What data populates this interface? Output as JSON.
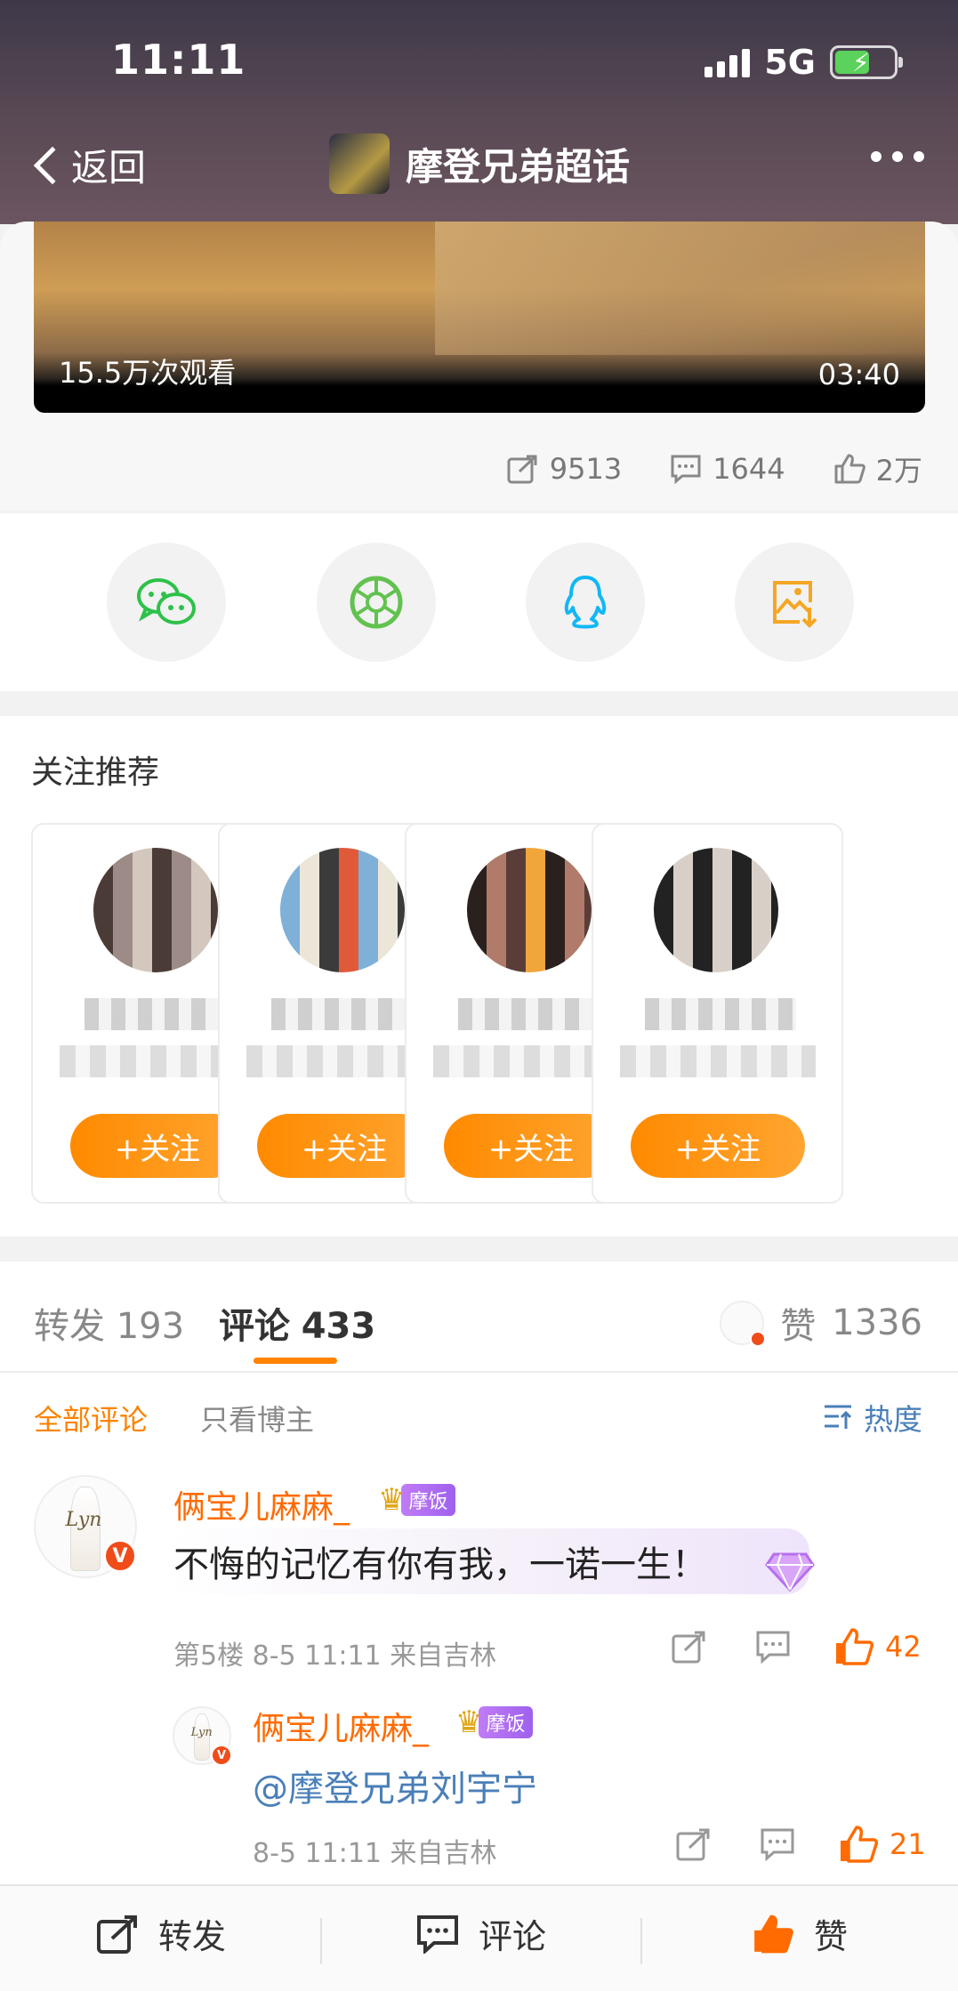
{
  "status_bar": {
    "time": "11:11",
    "network": "5G"
  },
  "nav": {
    "back_label": "返回",
    "title": "摩登兄弟超话"
  },
  "video": {
    "views": "15.5万次观看",
    "duration": "03:40"
  },
  "stats": {
    "reposts": "9513",
    "comments": "1644",
    "likes": "2万"
  },
  "share_targets": [
    {
      "icon": "wechat-icon",
      "color": "#2dc149"
    },
    {
      "icon": "moments-icon",
      "color": "#62c24f"
    },
    {
      "icon": "qq-icon",
      "color": "#12b7f5"
    },
    {
      "icon": "save-image-icon",
      "color": "#f5a623"
    }
  ],
  "recommend": {
    "title": "关注推荐",
    "follow_label": "+关注",
    "cards": [
      {},
      {},
      {},
      {}
    ]
  },
  "tabs": {
    "repost_label": "转发",
    "repost_count": "193",
    "comment_label": "评论",
    "comment_count": "433",
    "like_label": "赞",
    "like_count": "1336"
  },
  "filter": {
    "all": "全部评论",
    "host_only": "只看博主",
    "sort": "热度"
  },
  "comments": [
    {
      "name": "俩宝儿麻麻_",
      "badge": "摩饭",
      "text": "不悔的记忆有你有我，一诺一生！",
      "meta": "第5楼  8-5 11:11  来自吉林",
      "likes": "42"
    }
  ],
  "reply": {
    "name": "俩宝儿麻麻_",
    "badge": "摩饭",
    "text": "@摩登兄弟刘宇宁",
    "meta": "8-5 11:11  来自吉林",
    "likes": "21"
  },
  "bottom_bar": {
    "repost": "转发",
    "comment": "评论",
    "like": "赞"
  },
  "colors": {
    "accent": "#ff8200",
    "link": "#4a7fb8",
    "like": "#ff6b00"
  }
}
